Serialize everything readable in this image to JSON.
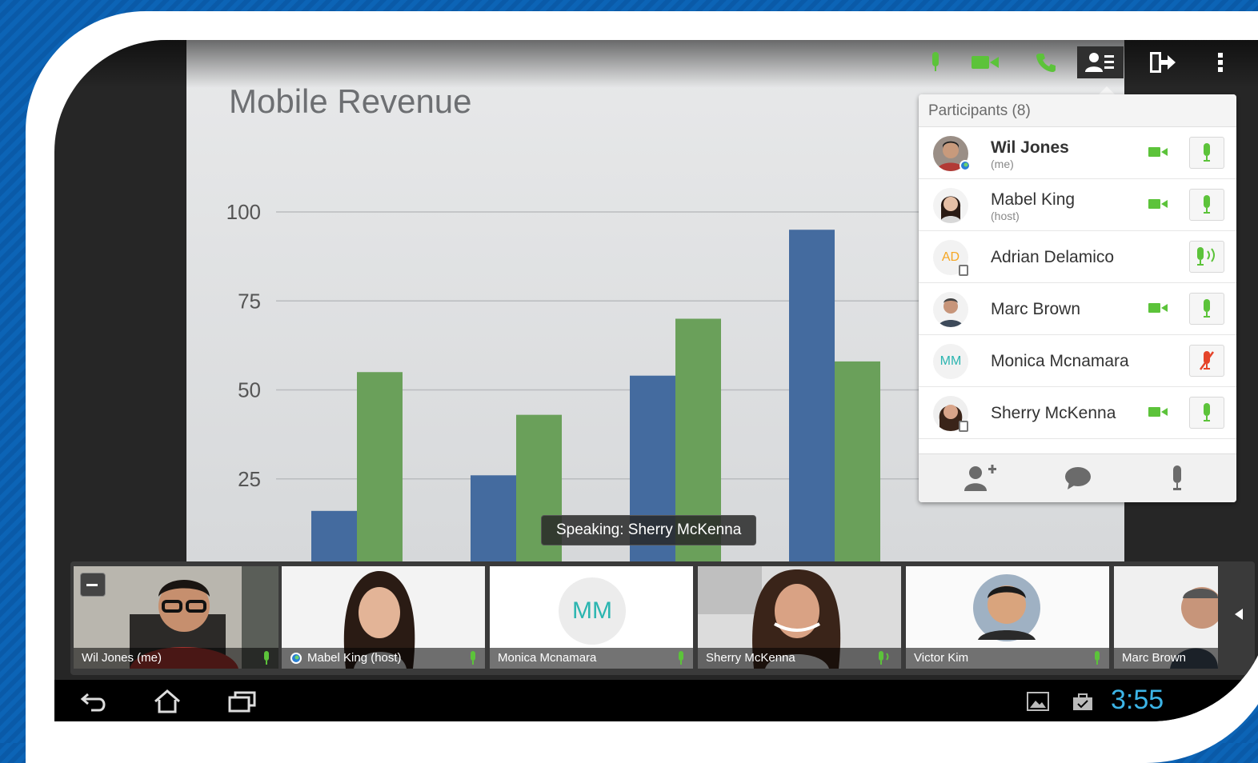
{
  "slide": {
    "title": "Mobile Revenue"
  },
  "chart_data": {
    "type": "bar",
    "title": "Mobile Revenue",
    "categories": [
      "",
      "",
      "",
      ""
    ],
    "series": [
      {
        "color": "#446b9f",
        "values": [
          16,
          26,
          54,
          95
        ]
      },
      {
        "color": "#6aa05a",
        "values": [
          55,
          43,
          70,
          58
        ]
      }
    ],
    "yticks": [
      "25",
      "50",
      "75",
      "100"
    ],
    "ylim": [
      0,
      100
    ],
    "grid": true
  },
  "toolbar": {
    "icons": [
      "mic-icon",
      "video-camera-icon",
      "phone-icon",
      "participants-list-icon",
      "exit-icon",
      "more-vert-icon"
    ],
    "active_color": "#5cc33a"
  },
  "participants": {
    "header": "Participants (8)",
    "items": [
      {
        "name": "Wil Jones",
        "role": "(me)",
        "video": true,
        "mic": "on"
      },
      {
        "name": "Mabel King",
        "role": "(host)",
        "video": true,
        "mic": "on"
      },
      {
        "name": "Adrian Delamico",
        "role": "",
        "initials": "AD",
        "initials_color": "#f5a623",
        "video": false,
        "mic": "speaking"
      },
      {
        "name": "Marc Brown",
        "role": "",
        "video": true,
        "mic": "on"
      },
      {
        "name": "Monica Mcnamara",
        "role": "",
        "initials": "MM",
        "initials_color": "#2bb5b0",
        "video": false,
        "mic": "muted"
      },
      {
        "name": "Sherry McKenna",
        "role": "",
        "video": true,
        "mic": "on"
      }
    ],
    "footer_icons": [
      "add-participant-icon",
      "chat-icon",
      "mic-icon"
    ]
  },
  "speaking_banner": "Speaking: Sherry McKenna",
  "filmstrip": {
    "tiles": [
      {
        "label": "Wil Jones (me)"
      },
      {
        "label": "Mabel King (host)"
      },
      {
        "label": "Monica Mcnamara",
        "initials": "MM"
      },
      {
        "label": "Sherry McKenna"
      },
      {
        "label": "Victor Kim"
      },
      {
        "label": "Marc Brown"
      }
    ]
  },
  "system_bar": {
    "clock": "3:55",
    "icons": [
      "back-icon",
      "home-icon",
      "recent-apps-icon",
      "gallery-icon",
      "shopping-bag-icon"
    ]
  }
}
